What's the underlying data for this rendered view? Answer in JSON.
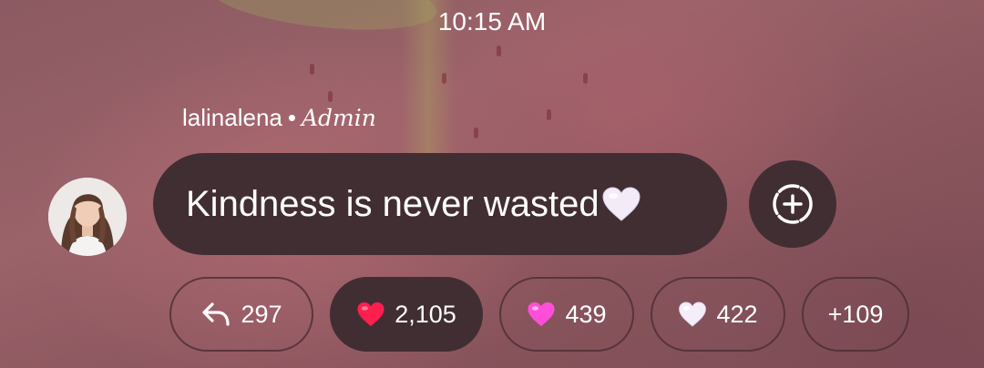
{
  "status_bar": {
    "time": "10:15 AM"
  },
  "message": {
    "sender_name": "lalinalena",
    "separator": "•",
    "sender_role": "Admin",
    "text": "Kindness is never wasted",
    "emoji_icon": "white-heart-icon"
  },
  "reactions": [
    {
      "icon": "reply-icon",
      "count": "297",
      "selected": false
    },
    {
      "icon": "red-heart-icon",
      "count": "2,105",
      "selected": true,
      "color": "#ff1f4e"
    },
    {
      "icon": "pink-heart-icon",
      "count": "439",
      "selected": false,
      "color": "#ff4fd8"
    },
    {
      "icon": "white-heart-icon",
      "count": "422",
      "selected": false,
      "color": "#f4eefa"
    },
    {
      "icon": null,
      "count": "+109",
      "selected": false
    }
  ],
  "add_reaction_icon": "add-reaction-icon",
  "colors": {
    "bubble": "#412e32",
    "text": "#ffffff"
  }
}
